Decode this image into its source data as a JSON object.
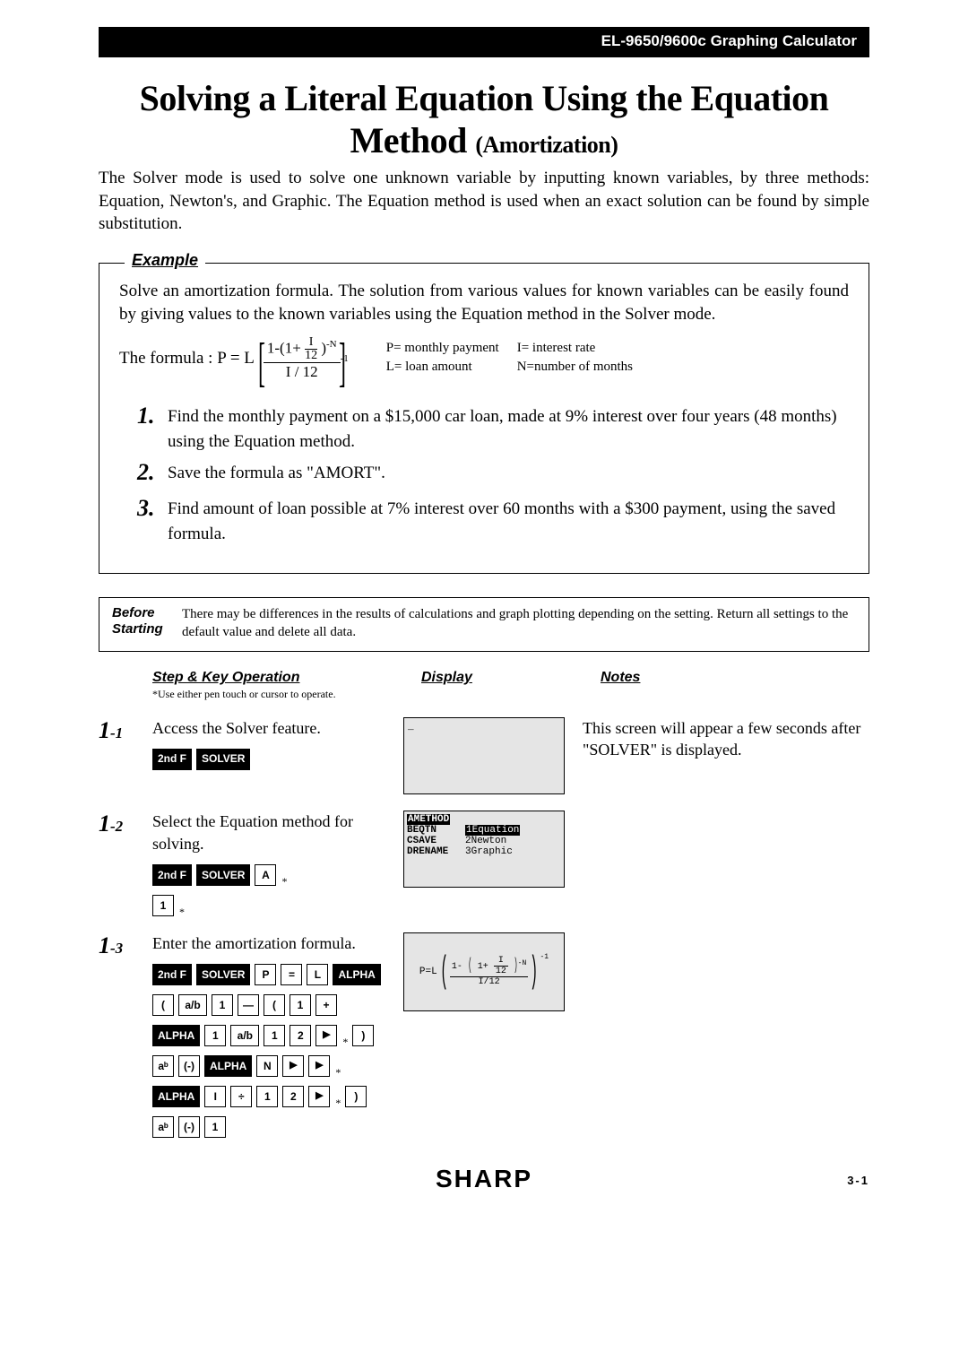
{
  "header": "EL-9650/9600c Graphing Calculator",
  "title_main": "Solving a Literal Equation Using the Equation Method",
  "title_sub": "(Amortization)",
  "intro": "The Solver mode is used to solve one unknown variable by inputting known variables, by three methods: Equation, Newton's, and Graphic. The Equation method is used when an exact solution can be found by simple substitution.",
  "example_label": "Example",
  "example_intro": "Solve an amortization formula. The solution from various values for known variables can be easily found by giving values to the known variables using the Equation method in the Solver mode.",
  "formula_prefix": "The formula : P = L",
  "formula_num_text": "1-(1+",
  "formula_inner_num": "I",
  "formula_inner_den": "12",
  "formula_num_tail": ")",
  "formula_num_exp": "-N",
  "formula_den": "I / 12",
  "formula_outer_exp": "-1",
  "legend": {
    "p": "P= monthly payment",
    "i": "I= interest rate",
    "l": "L= loan amount",
    "n": "N=number of months"
  },
  "tasks": [
    {
      "num": "1.",
      "text": "Find the monthly payment on a $15,000 car loan, made at 9% interest over four years (48 months) using the Equation method."
    },
    {
      "num": "2.",
      "text": "Save the formula as \"AMORT\"."
    },
    {
      "num": "3.",
      "text": "Find amount of loan possible at 7% interest over 60 months with a $300 payment, using the saved formula."
    }
  ],
  "before_label_1": "Before",
  "before_label_2": "Starting",
  "before_text": "There may be differences in the results of calculations and graph plotting depending on the setting. Return all settings to the default value and delete all data.",
  "col_step": "Step & Key Operation",
  "col_display": "Display",
  "col_notes": "Notes",
  "footnote": "*Use either pen touch or cursor to operate.",
  "steps": {
    "s1": {
      "num": "1",
      "sub": "-1",
      "op": "Access the Solver feature.",
      "notes": "This screen will appear a few seconds after \"SOLVER\" is displayed."
    },
    "s2": {
      "num": "1",
      "sub": "-2",
      "op": "Select the Equation method for solving."
    },
    "s3": {
      "num": "1",
      "sub": "-3",
      "op": "Enter the amortization formula."
    }
  },
  "lcd1_cursor": "_",
  "lcd2": {
    "left_title": "AMETHOD",
    "left_items": [
      "BEQTN",
      "CSAVE",
      "DRENAME"
    ],
    "right_items": [
      "1Equation",
      "2Newton",
      "3Graphic"
    ]
  },
  "lcd3": {
    "pre": "P=L",
    "num_pre": "1-",
    "inner_pre": "1+",
    "inner_num": "I",
    "inner_den": "12",
    "inner_exp": "-N",
    "den": "I/12",
    "outer_exp": "-1"
  },
  "keys": {
    "secondf": "2nd F",
    "solver": "SOLVER",
    "A": "A",
    "one": "1",
    "P": "P",
    "eq": "=",
    "L": "L",
    "alpha": "ALPHA",
    "lparen": "(",
    "rparen": ")",
    "ab": "a/b",
    "minus": "—",
    "plus": "+",
    "two": "2",
    "pow": "aᵇ",
    "neg": "(-)",
    "N": "N",
    "I": "I",
    "div": "÷"
  },
  "brand": "SHARP",
  "page_num": "3-1"
}
